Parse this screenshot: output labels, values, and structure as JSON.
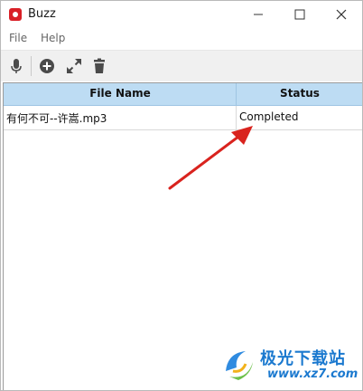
{
  "window": {
    "title": "Buzz",
    "controls": {
      "minimize": "—",
      "maximize": "☐",
      "close": "✕"
    }
  },
  "menubar": {
    "items": [
      "File",
      "Help"
    ]
  },
  "toolbar": {
    "icons": [
      "microphone-icon",
      "add-circle-icon",
      "expand-icon",
      "trash-icon"
    ]
  },
  "table": {
    "columns": [
      "File Name",
      "Status"
    ],
    "rows": [
      {
        "file_name": "有何不可--许嵩.mp3",
        "status": "Completed"
      }
    ]
  },
  "annotation": {
    "arrow_color": "#d9231e"
  },
  "watermark": {
    "text_cn": "极光下载站",
    "url": "www.xz7.com"
  },
  "colors": {
    "header_bg": "#bddcf3",
    "app_icon": "#d92027",
    "watermark": "#1b79cf"
  }
}
